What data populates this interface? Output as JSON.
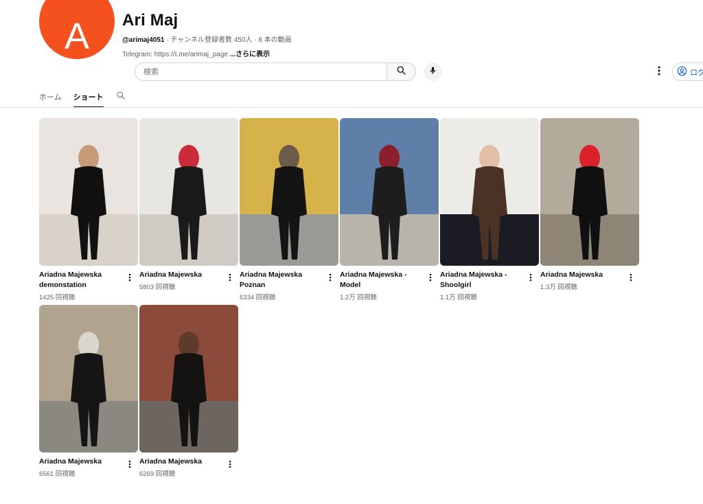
{
  "channel": {
    "name": "Ari Maj",
    "avatar_letter": "A",
    "avatar_color": "#f4511e",
    "handle": "@arimaj4051",
    "stats": " · チャンネル登録者数 450人 · 8 本の動画",
    "description": "Telegram: https://t.me/arimaj_page ",
    "more_label": "...さらに表示"
  },
  "search": {
    "placeholder": "検索",
    "search_icon": "search-icon",
    "mic_icon": "microphone-icon"
  },
  "header": {
    "menu_icon": "more-vert-icon",
    "login_label": "ログ",
    "login_icon": "account-circle-icon"
  },
  "tabs": [
    {
      "label": "ホーム",
      "active": false
    },
    {
      "label": "ショート",
      "active": true
    }
  ],
  "shorts": [
    {
      "title": "Ariadna Majewska demonstation",
      "views": "1425 回視聴",
      "palette": [
        "#e9e4df",
        "#c79a7a",
        "#111111",
        "#d8d2c8"
      ]
    },
    {
      "title": "Ariadna Majewska",
      "views": "5803 回視聴",
      "palette": [
        "#e8e6e3",
        "#cc2b3a",
        "#1a1a1a",
        "#cfcac3"
      ]
    },
    {
      "title": "Ariadna Majewska Poznan",
      "views": "5334 回視聴",
      "palette": [
        "#d5b24a",
        "#6c5a4a",
        "#141414",
        "#9a9a96"
      ]
    },
    {
      "title": "Ariadna Majewska - Model",
      "views": "1.2万 回視聴",
      "palette": [
        "#5f7fa8",
        "#8c1f2b",
        "#1d1d1d",
        "#b9b4ab"
      ]
    },
    {
      "title": "Ariadna Majewska - Shoolgirl",
      "views": "1.1万 回視聴",
      "palette": [
        "#ecebe8",
        "#e2c0a8",
        "#4a3224",
        "#1b1b24"
      ]
    },
    {
      "title": "Ariadna Majewska",
      "views": "1.3万 回視聴",
      "palette": [
        "#b3aa9c",
        "#d9222b",
        "#101010",
        "#8f8577"
      ]
    },
    {
      "title": "Ariadna Majewska",
      "views": "6561 回視聴",
      "palette": [
        "#b0a48e",
        "#d9d6cf",
        "#151515",
        "#8a8880"
      ]
    },
    {
      "title": "Ariadna Majewska",
      "views": "6269 回視聴",
      "palette": [
        "#8b4a3a",
        "#5d3a2c",
        "#151312",
        "#6d6560"
      ]
    }
  ]
}
